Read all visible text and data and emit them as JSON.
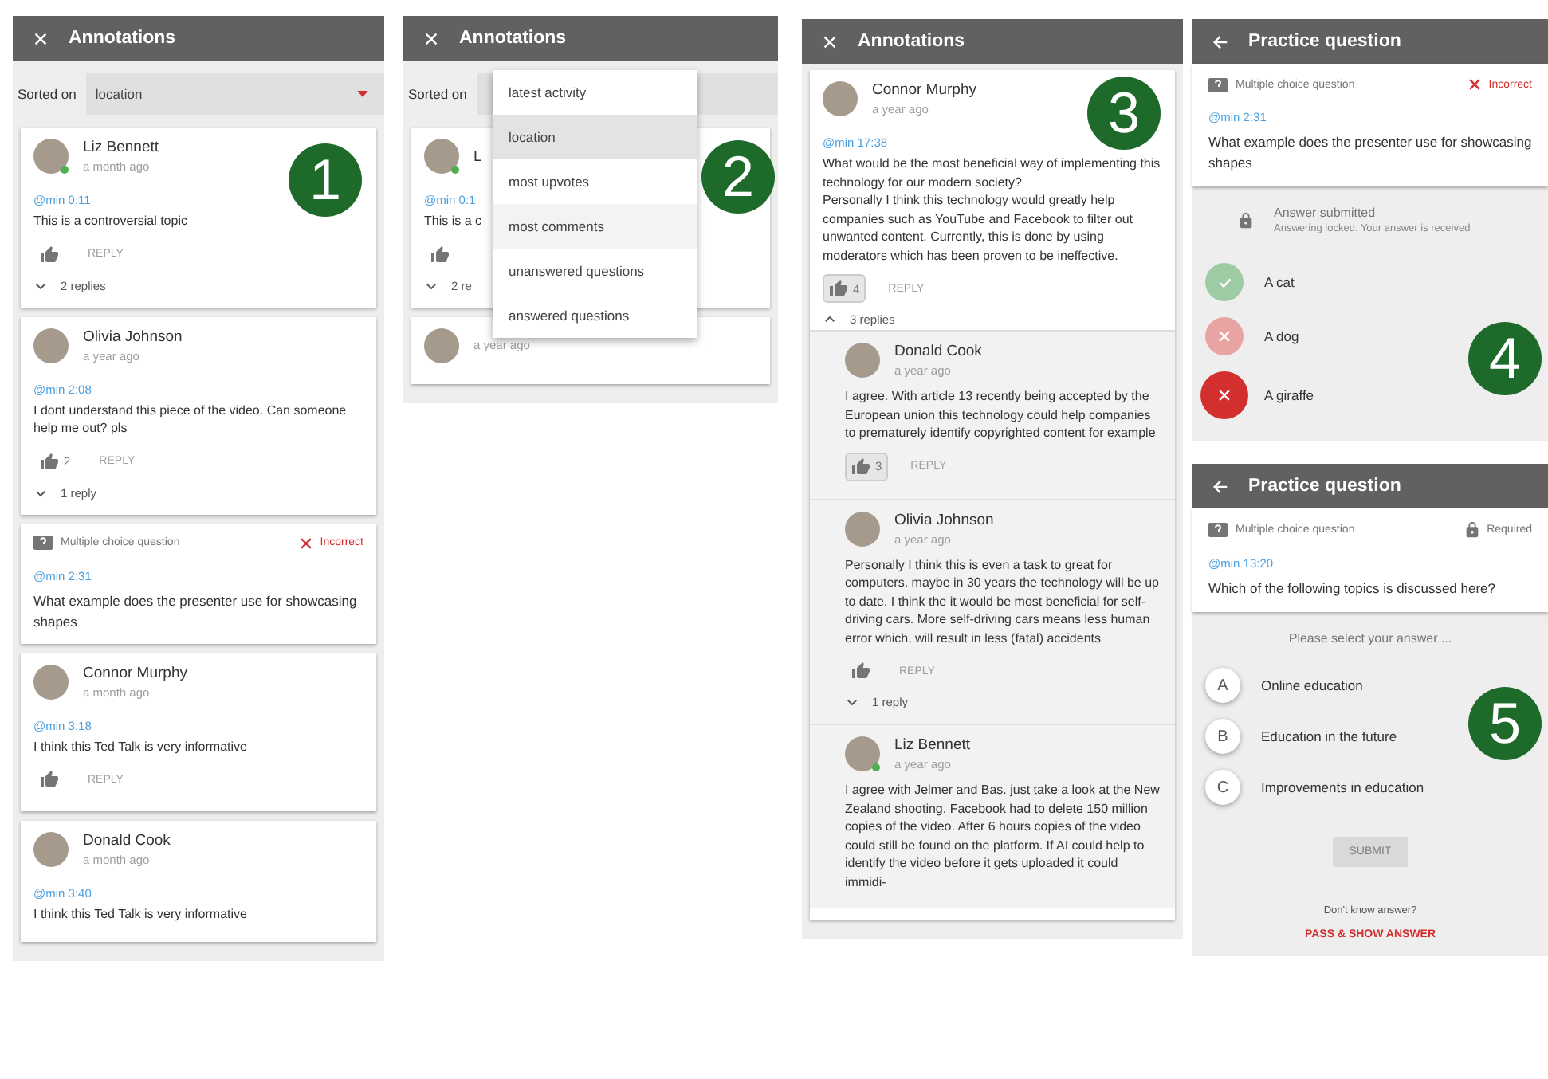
{
  "panels": [
    {
      "kind": "annotations",
      "badge": "1",
      "header": {
        "kind": "close",
        "title": "Annotations"
      },
      "sort": {
        "label": "Sorted on",
        "value": "location"
      },
      "items": [
        {
          "kind": "comment",
          "author": "Liz Bennett",
          "online": true,
          "time": "a month ago",
          "timestamp": "@min 0:11",
          "text": "This is a controversial topic",
          "liked": false,
          "reply_label": "REPLY",
          "reply_count": "2 replies",
          "expanded": false
        },
        {
          "kind": "comment",
          "author": "Olivia Johnson",
          "online": false,
          "time": "a year ago",
          "timestamp": "@min 2:08",
          "text": "I dont understand this piece of the video. Can someone help me out? pls",
          "liked": false,
          "likes": "2",
          "reply_label": "REPLY",
          "reply_count": "1 reply",
          "expanded": false
        },
        {
          "kind": "question",
          "type": "Multiple choice question",
          "status": "Incorrect",
          "incorrect": true,
          "timestamp": "@min 2:31",
          "text": "What example does the presenter use for showcasing shapes"
        },
        {
          "kind": "comment",
          "author": "Connor Murphy",
          "online": false,
          "time": "a month ago",
          "timestamp": "@min 3:18",
          "text": "I think this Ted Talk is very informative",
          "liked": false,
          "reply_label": "REPLY"
        },
        {
          "kind": "comment",
          "author": "Donald Cook",
          "online": false,
          "time": "a month ago",
          "timestamp": "@min 3:40",
          "text": "I think this Ted Talk is very informative"
        }
      ]
    },
    {
      "kind": "annotations",
      "badge": "2",
      "header": {
        "kind": "close",
        "title": "Annotations"
      },
      "sort": {
        "label": "Sorted on"
      },
      "menu": [
        {
          "label": "latest activity",
          "selected": false,
          "highlighted": false
        },
        {
          "label": "location",
          "selected": true,
          "highlighted": false
        },
        {
          "label": "most upvotes",
          "selected": false,
          "highlighted": false
        },
        {
          "label": "most comments",
          "selected": false,
          "highlighted": true
        },
        {
          "label": "unanswered questions",
          "selected": false,
          "highlighted": false
        },
        {
          "label": "answered questions",
          "selected": false,
          "highlighted": false
        }
      ],
      "items": [
        {
          "kind": "comment",
          "author": "L",
          "online": true,
          "timestamp": "@min 0:1",
          "text": "This is a c",
          "liked": false,
          "reply_count": "2 re",
          "expanded": false
        },
        {
          "kind": "comment",
          "online": false,
          "time": "a year ago"
        }
      ]
    },
    {
      "kind": "annotations",
      "badge": "3",
      "header": {
        "kind": "close",
        "title": "Annotations"
      },
      "items": [
        {
          "kind": "comment",
          "author": "Connor Murphy",
          "online": false,
          "time": "a year ago",
          "timestamp": "@min 17:38",
          "text": "What would be the most beneficial way of implementing this technology for our modern society?\nPersonally I think this technology would greatly help companies such as YouTube and Facebook to filter out unwanted content. Currently, this is done by using moderators which has been proven to be ineffective.",
          "liked": true,
          "likes": "4",
          "reply_label": "REPLY",
          "reply_count": "3 replies",
          "expanded": true,
          "children": [
            {
              "kind": "comment",
              "author": "Donald Cook",
              "online": false,
              "time": "a year ago",
              "text": "I agree. With article 13 recently being accepted by the European union this technology could help companies to prematurely identify copyrighted content for example",
              "liked": true,
              "likes": "3",
              "reply_label": "REPLY"
            },
            {
              "kind": "comment",
              "author": "Olivia Johnson",
              "online": false,
              "time": "a year ago",
              "text": "Personally I think this is even a task to great for computers. maybe in 30 years the technology will be up to date. I think the it would be most beneficial for self-driving cars. More self-driving cars means less human error which, will result in less (fatal) accidents",
              "liked": false,
              "reply_label": "REPLY",
              "reply_count": "1 reply",
              "expanded": false
            },
            {
              "kind": "comment",
              "author": "Liz Bennett",
              "online": true,
              "time": "a year ago",
              "text": "I agree with Jelmer and Bas. just take a look at the New Zealand shooting. Facebook had to delete 150 million copies of the video. After 6 hours copies of the video could still be found on the platform. If AI could help to identify the video before it gets uploaded it could immidi-"
            }
          ]
        }
      ]
    },
    {
      "kind": "question",
      "badge": "4",
      "header": {
        "kind": "back",
        "title": "Practice question"
      },
      "question": {
        "type": "Multiple choice question",
        "status": "Incorrect",
        "incorrect": true,
        "timestamp": "@min 2:31",
        "text": "What example does the presenter use for showcasing shapes"
      },
      "submitted": {
        "title": "Answer submitted",
        "subtitle": "Answering locked. Your answer is received"
      },
      "options": [
        {
          "kind": "result",
          "label": "A cat",
          "correct": true,
          "selected": false
        },
        {
          "kind": "result",
          "label": "A dog",
          "correct": false,
          "selected": false
        },
        {
          "kind": "result",
          "label": "A giraffe",
          "correct": false,
          "selected": true
        }
      ]
    },
    {
      "kind": "question",
      "badge": "5",
      "header": {
        "kind": "back",
        "title": "Practice question"
      },
      "question": {
        "type": "Multiple choice question",
        "status": "Required",
        "incorrect": false,
        "timestamp": "@min 13:20",
        "text": "Which of the following topics is discussed here?"
      },
      "prompt": "Please select your answer ...",
      "options": [
        {
          "kind": "letter",
          "letter": "A",
          "label": "Online education",
          "selected": false
        },
        {
          "kind": "letter",
          "letter": "B",
          "label": "Education in the future",
          "selected": false
        },
        {
          "kind": "letter",
          "letter": "C",
          "label": "Improvements in education",
          "selected": false
        }
      ],
      "submit": {
        "label": "SUBMIT",
        "disabled": true
      },
      "help": "Don't know answer?",
      "pass_link": "PASS & SHOW ANSWER"
    }
  ]
}
